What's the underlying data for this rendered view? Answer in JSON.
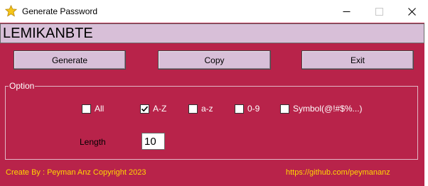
{
  "window": {
    "title": "Generate Password",
    "icon": "star-icon",
    "controls": [
      "minimize-icon",
      "maximize-icon",
      "close-icon"
    ]
  },
  "password": {
    "value": "LEMIKANBTE"
  },
  "buttons": {
    "generate": "Generate",
    "copy": "Copy",
    "exit": "Exit"
  },
  "options": {
    "group_label": "Option",
    "all": {
      "label": "All",
      "checked": false
    },
    "upper": {
      "label": "A-Z",
      "checked": true
    },
    "lower": {
      "label": "a-z",
      "checked": false
    },
    "digits": {
      "label": "0-9",
      "checked": false
    },
    "symbol": {
      "label": "Symbol(@!#$%...)",
      "checked": false
    }
  },
  "length": {
    "label": "Length",
    "value": "10"
  },
  "footer": {
    "credit": "Create By : Peyman Anz Copyright 2023",
    "link": "https://github.com/peymananz"
  },
  "colors": {
    "background": "#b8234a",
    "control_face": "#d8bfd8",
    "footer_text": "#ffd700",
    "option_text": "#ffffff"
  }
}
